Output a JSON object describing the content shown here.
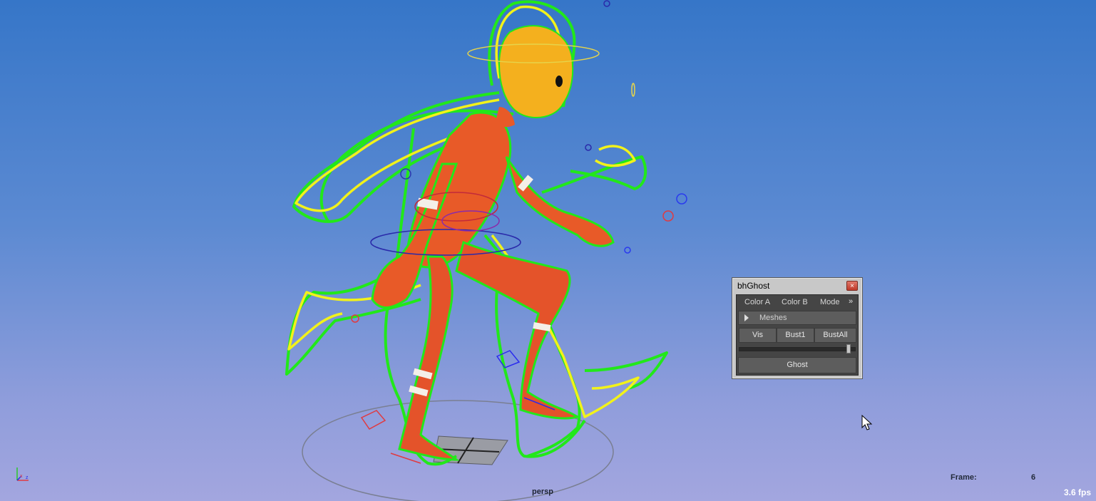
{
  "viewport": {
    "camera_label": "persp",
    "frame_label": "Frame:",
    "frame_value": "6",
    "fps": "3.6 fps",
    "axis_labels": {
      "y": "y",
      "x": "x",
      "z": "z"
    }
  },
  "tool_window": {
    "title": "bhGhost",
    "close_glyph": "×",
    "menu": {
      "color_a": "Color A",
      "color_b": "Color B",
      "mode": "Mode",
      "more": "»"
    },
    "meshes_label": "Meshes",
    "buttons": {
      "vis": "Vis",
      "bust1": "Bust1",
      "bustall": "BustAll",
      "ghost": "Ghost"
    },
    "slider_fraction": 0.96
  },
  "colors": {
    "ghost_green": "#22e81a",
    "ghost_yellow": "#f2f21a",
    "character_orange": "#e85a28",
    "head_yellow": "#f4b01e",
    "bg_top": "#3676c8",
    "bg_bottom": "#a3a6df"
  }
}
